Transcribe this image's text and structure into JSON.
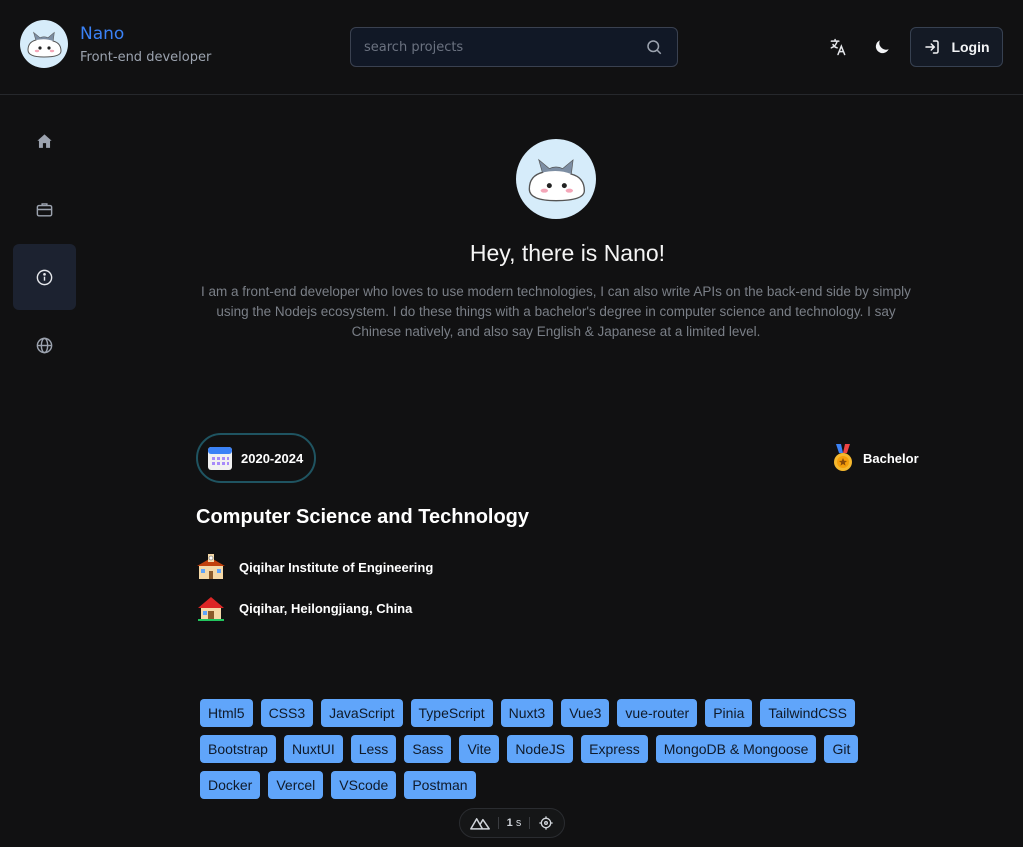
{
  "header": {
    "name": "Nano",
    "role": "Front-end developer",
    "search_placeholder": "search projects",
    "login_label": "Login"
  },
  "sidebar": {
    "items": [
      {
        "icon": "home-icon",
        "active": false
      },
      {
        "icon": "briefcase-icon",
        "active": false
      },
      {
        "icon": "info-icon",
        "active": true
      },
      {
        "icon": "globe-icon",
        "active": false
      }
    ]
  },
  "hero": {
    "title": "Hey, there is Nano!",
    "description": "I am a front-end developer who loves to use modern technologies, I can also write APIs on the back-end side by simply using the Nodejs ecosystem. I do these things with a bachelor's degree in computer science and technology. I say Chinese natively, and also say English & Japanese at a limited level."
  },
  "education": {
    "period": "2020-2024",
    "degree": "Bachelor",
    "major": "Computer Science and Technology",
    "school": "Qiqihar Institute of Engineering",
    "location": "Qiqihar, Heilongjiang, China"
  },
  "skills": [
    "Html5",
    "CSS3",
    "JavaScript",
    "TypeScript",
    "Nuxt3",
    "Vue3",
    "vue-router",
    "Pinia",
    "TailwindCSS",
    "Bootstrap",
    "NuxtUI",
    "Less",
    "Sass",
    "Vite",
    "NodeJS",
    "Express",
    "MongoDB & Mongoose",
    "Git",
    "Docker",
    "Vercel",
    "VScode",
    "Postman"
  ],
  "devtools": {
    "time_value": "1",
    "time_unit": "s"
  },
  "colors": {
    "accent": "#3b82f6",
    "tag_bg": "#60a5fa",
    "background": "#111112"
  }
}
